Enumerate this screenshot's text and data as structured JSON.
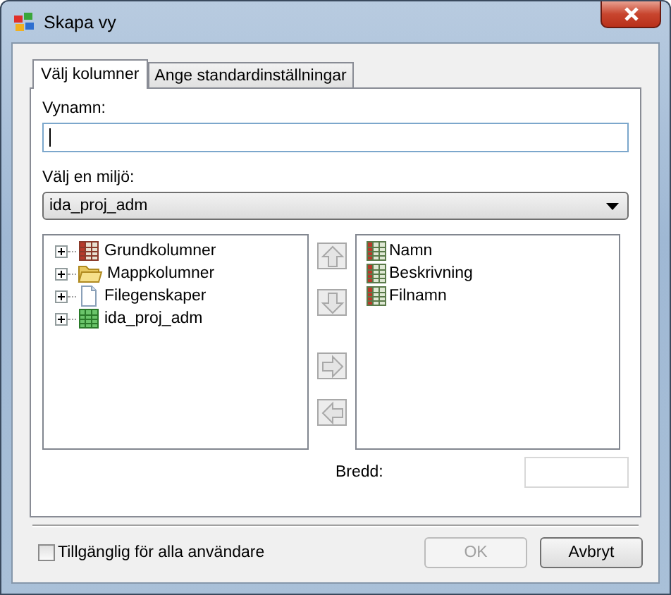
{
  "window": {
    "title": "Skapa vy"
  },
  "tabs": [
    {
      "label": "Välj kolumner",
      "selected": true
    },
    {
      "label": "Ange standardinställningar",
      "selected": false
    }
  ],
  "view_name": {
    "label": "Vynamn:"
  },
  "environment": {
    "label": "Välj en miljö:",
    "value": "ida_proj_adm"
  },
  "available_tree": [
    {
      "label": "Grundkolumner",
      "kind": "table",
      "expanded": false
    },
    {
      "label": "Mappkolumner",
      "kind": "folder",
      "expanded": false
    },
    {
      "label": "Filegenskaper",
      "kind": "file",
      "expanded": false
    },
    {
      "label": "ida_proj_adm",
      "kind": "grid",
      "expanded": false
    }
  ],
  "move_buttons": [
    {
      "kind": "up",
      "disabled": true
    },
    {
      "kind": "down",
      "disabled": true
    },
    {
      "kind": "right",
      "disabled": true
    },
    {
      "kind": "left",
      "disabled": true
    }
  ],
  "selected_columns": [
    {
      "label": "Namn"
    },
    {
      "label": "Beskrivning"
    },
    {
      "label": "Filnamn"
    }
  ],
  "width_field": {
    "label": "Bredd:"
  },
  "shared_checkbox": {
    "label": "Tillgänglig för alla användare",
    "checked": false
  },
  "buttons": [
    {
      "label": "OK",
      "disabled": true
    },
    {
      "label": "Avbryt",
      "disabled": false
    }
  ]
}
